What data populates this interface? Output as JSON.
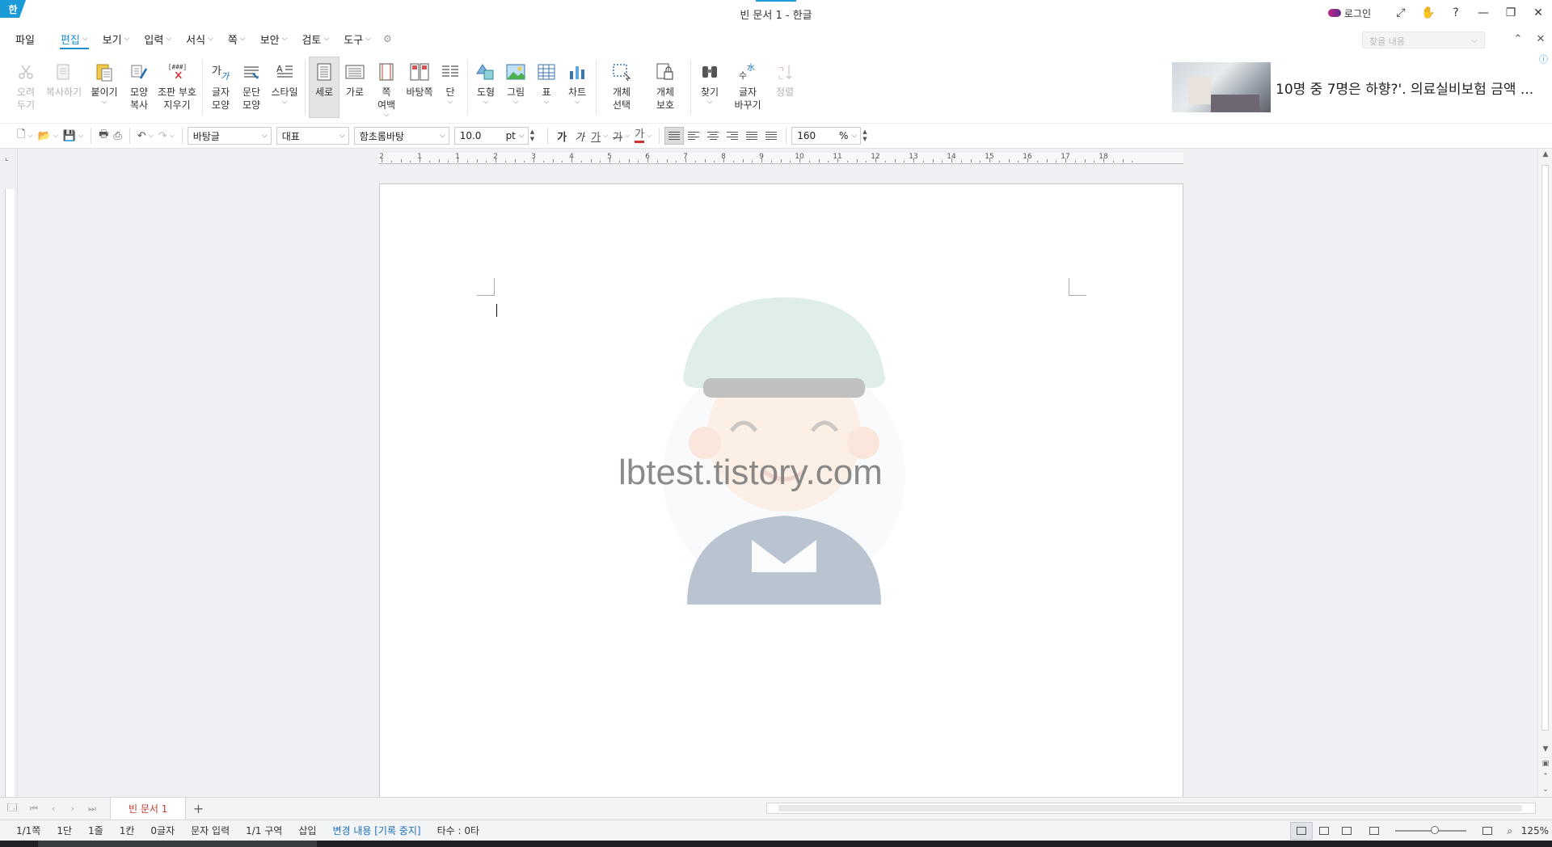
{
  "window": {
    "app_logo": "한",
    "title": "빈 문서 1 - 한글",
    "login_label": "로그인"
  },
  "menu": {
    "items": [
      {
        "label": "편집"
      },
      {
        "label": "보기"
      },
      {
        "label": "입력"
      },
      {
        "label": "서식"
      },
      {
        "label": "쪽"
      },
      {
        "label": "보안"
      },
      {
        "label": "검토"
      },
      {
        "label": "도구"
      }
    ],
    "file_label": "파일",
    "search_placeholder": "찾을 내용"
  },
  "ribbon": {
    "buttons": [
      {
        "label": "오려\n두기",
        "icon": "scissors-icon"
      },
      {
        "label": "복사하기",
        "icon": "copy-icon"
      },
      {
        "label": "붙이기",
        "icon": "paste-icon"
      },
      {
        "label": "모양\n복사",
        "icon": "format-painter-icon"
      },
      {
        "label": "조판 부호\n지우기",
        "icon": "clear-format-icon"
      },
      {
        "label": "글자\n모양",
        "icon": "char-format-icon"
      },
      {
        "label": "문단\n모양",
        "icon": "paragraph-format-icon"
      },
      {
        "label": "스타일",
        "icon": "style-icon"
      },
      {
        "label": "세로",
        "icon": "portrait-icon"
      },
      {
        "label": "가로",
        "icon": "landscape-icon"
      },
      {
        "label": "쪽\n여백",
        "icon": "page-margin-icon"
      },
      {
        "label": "바탕쪽",
        "icon": "master-page-icon"
      },
      {
        "label": "단",
        "icon": "columns-icon"
      },
      {
        "label": "도형",
        "icon": "shape-icon"
      },
      {
        "label": "그림",
        "icon": "picture-icon"
      },
      {
        "label": "표",
        "icon": "table-icon"
      },
      {
        "label": "차트",
        "icon": "chart-icon"
      },
      {
        "label": "개체\n선택",
        "icon": "object-select-icon"
      },
      {
        "label": "개체\n보호",
        "icon": "object-protect-icon"
      },
      {
        "label": "찾기",
        "icon": "binoculars-icon"
      },
      {
        "label": "글자\n바꾸기",
        "icon": "char-convert-icon"
      },
      {
        "label": "정렬",
        "icon": "sort-icon"
      }
    ],
    "ad_text": "10명 중 7명은 하향?'. 의료실비보험 금액 ..."
  },
  "format": {
    "style_combo": "바탕글",
    "lang_combo": "대표",
    "font_combo": "함초롬바탕",
    "size_value": "10.0",
    "size_unit": "pt",
    "line_spacing_value": "160",
    "line_spacing_unit": "%",
    "bold_glyph": "가",
    "italic_glyph": "가",
    "underline_glyph": "가",
    "strike_glyph": "가",
    "color_glyph": "가"
  },
  "ruler": {
    "h_numbers": [
      "2",
      "1",
      "1",
      "2",
      "3",
      "4",
      "5",
      "6",
      "7",
      "8",
      "9",
      "10",
      "11",
      "12",
      "13",
      "14",
      "15",
      "16",
      "17",
      "18"
    ]
  },
  "document": {
    "watermark_text": "lbtest.tistory.com"
  },
  "tabs": {
    "doc_tab": "빈 문서 1"
  },
  "status": {
    "page": "1/1쪽",
    "column": "1단",
    "line": "1줄",
    "col": "1칸",
    "chars": "0글자",
    "mode": "문자 입력",
    "section": "1/1 구역",
    "insert": "삽입",
    "track_changes": "변경 내용 [기록 중지]",
    "typing_speed": "타수 : 0타",
    "zoom": "125%"
  },
  "colors": {
    "accent": "#1a8fd0",
    "tab_text": "#c0392b"
  }
}
